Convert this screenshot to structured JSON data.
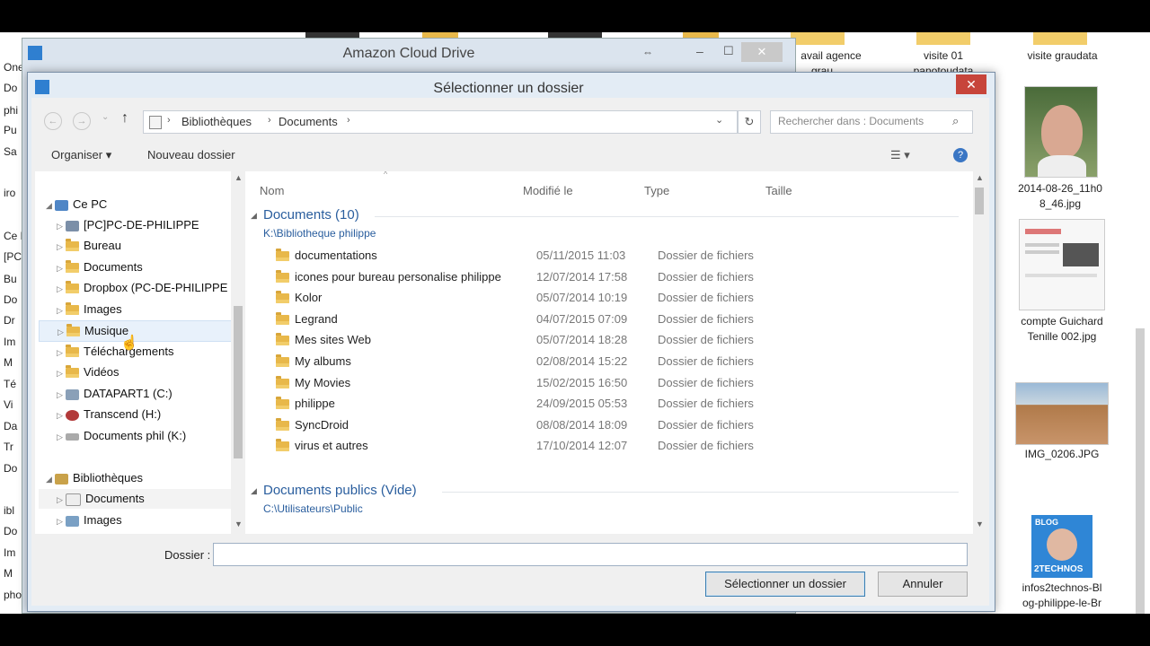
{
  "desktop": {
    "left_strip": [
      "One",
      "Do",
      "phi",
      "Pu",
      "Sa",
      "iro",
      "Ce P",
      "[PC",
      "Bu",
      "Do",
      "Dr",
      "Im",
      "M",
      "Té",
      "Vi",
      "Da",
      "Tr",
      "Do",
      "ibl",
      "Do",
      "Im",
      "M",
      "pho"
    ],
    "icons_top": [
      {
        "label": "avail agence",
        "sub": "grau"
      },
      {
        "label": "visite 01",
        "sub": "panotoudata"
      },
      {
        "label": "visite graudata",
        "sub": ""
      }
    ],
    "files": [
      {
        "label1": "2014-08-26_11h0",
        "label2": "8_46.jpg"
      },
      {
        "label1": "compte Guichard",
        "label2": "Tenille 002.jpg"
      },
      {
        "label1": "IMG_0206.JPG",
        "label2": ""
      },
      {
        "label1": "infos2technos-Bl",
        "label2": "og-philippe-le-Br"
      }
    ],
    "blog_badge": {
      "top": "BLOG",
      "bottom": "2TECHNOS"
    }
  },
  "bg_window": {
    "title": "Amazon Cloud Drive"
  },
  "dialog": {
    "title": "Sélectionner un dossier",
    "close": "✕",
    "breadcrumb": [
      "Bibliothèques",
      "Documents"
    ],
    "search_placeholder": "Rechercher dans : Documents",
    "toolbar": {
      "organize": "Organiser ▾",
      "new_folder": "Nouveau dossier"
    },
    "tree": {
      "ce_pc": "Ce PC",
      "items": [
        "[PC]PC-DE-PHILIPPE",
        "Bureau",
        "Documents",
        "Dropbox (PC-DE-PHILIPPE",
        "Images",
        "Musique",
        "Téléchargements",
        "Vidéos",
        "DATAPART1 (C:)",
        "Transcend (H:)",
        "Documents phil (K:)"
      ],
      "libraries": "Bibliothèques",
      "lib_items": [
        "Documents",
        "Images"
      ]
    },
    "columns": {
      "name": "Nom",
      "modified": "Modifié le",
      "type": "Type",
      "size": "Taille"
    },
    "groups": [
      {
        "title": "Documents (10)",
        "path": "K:\\Bibliotheque philippe",
        "rows": [
          {
            "name": "documentations",
            "date": "05/11/2015 11:03",
            "type": "Dossier de fichiers"
          },
          {
            "name": "icones pour bureau personalise philippe",
            "date": "12/07/2014 17:58",
            "type": "Dossier de fichiers"
          },
          {
            "name": "Kolor",
            "date": "05/07/2014 10:19",
            "type": "Dossier de fichiers"
          },
          {
            "name": "Legrand",
            "date": "04/07/2015 07:09",
            "type": "Dossier de fichiers"
          },
          {
            "name": "Mes sites Web",
            "date": "05/07/2014 18:28",
            "type": "Dossier de fichiers"
          },
          {
            "name": "My albums",
            "date": "02/08/2014 15:22",
            "type": "Dossier de fichiers"
          },
          {
            "name": "My Movies",
            "date": "15/02/2015 16:50",
            "type": "Dossier de fichiers"
          },
          {
            "name": "philippe",
            "date": "24/09/2015 05:53",
            "type": "Dossier de fichiers"
          },
          {
            "name": "SyncDroid",
            "date": "08/08/2014 18:09",
            "type": "Dossier de fichiers"
          },
          {
            "name": "virus et autres",
            "date": "17/10/2014 12:07",
            "type": "Dossier de fichiers"
          }
        ]
      },
      {
        "title": "Documents publics (Vide)",
        "path": "C:\\Utilisateurs\\Public",
        "rows": []
      }
    ],
    "folder_label": "Dossier :",
    "folder_value": "",
    "select_button": "Sélectionner un dossier",
    "cancel_button": "Annuler"
  }
}
